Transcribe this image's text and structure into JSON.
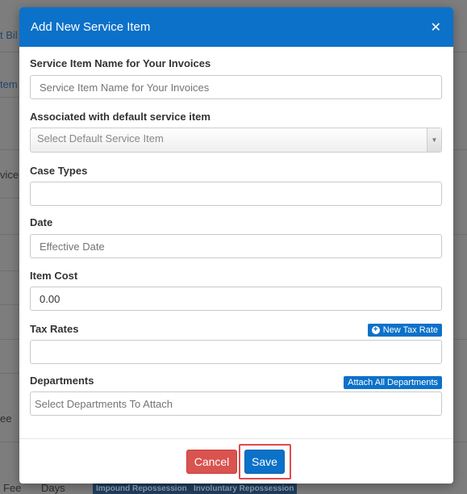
{
  "background": {
    "fragments": [
      {
        "text": "t Bil"
      },
      {
        "text": "tem"
      },
      {
        "text": "vice"
      },
      {
        "text": "ee"
      },
      {
        "text": "Fee"
      },
      {
        "text": "Days"
      }
    ],
    "badges": [
      "Impound Repossession",
      "Involuntary Repossession"
    ]
  },
  "modal": {
    "title": "Add New Service Item",
    "close_glyph": "✕",
    "fields": {
      "name": {
        "label": "Service Item Name for Your Invoices",
        "placeholder": "Service Item Name for Your Invoices"
      },
      "default_item": {
        "label": "Associated with default service item",
        "placeholder": "Select Default Service Item"
      },
      "case_types": {
        "label": "Case Types",
        "value": ""
      },
      "date": {
        "label": "Date",
        "placeholder": "Effective Date"
      },
      "item_cost": {
        "label": "Item Cost",
        "value": "0.00"
      },
      "tax_rates": {
        "label": "Tax Rates",
        "button_label": "New Tax Rate",
        "value": ""
      },
      "departments": {
        "label": "Departments",
        "button_label": "Attach All Departments",
        "placeholder": "Select Departments To Attach"
      }
    },
    "footer": {
      "cancel_label": "Cancel",
      "save_label": "Save"
    }
  },
  "colors": {
    "primary": "#0c71c9",
    "danger": "#d9534f",
    "highlight": "#e24a4a"
  },
  "icons": {
    "close": "close-icon",
    "plus": "plus-circle-icon",
    "dropdown": "caret-down-icon"
  }
}
